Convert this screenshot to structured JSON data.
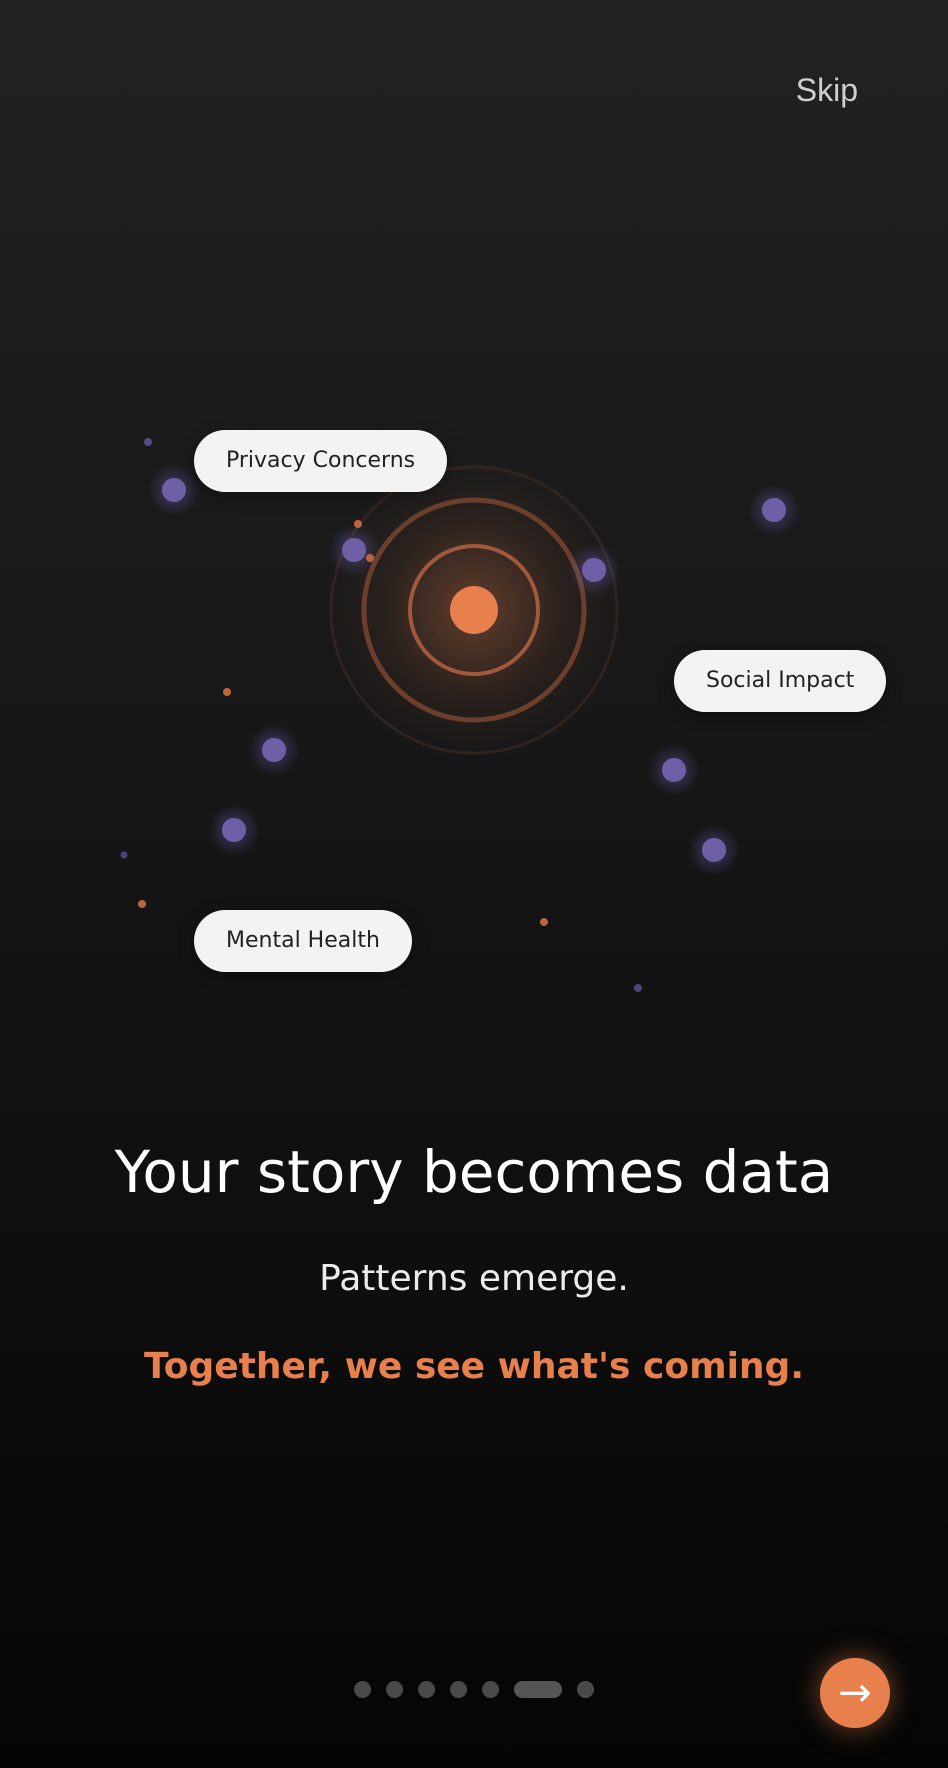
{
  "header": {
    "skip_label": "Skip"
  },
  "topics": {
    "privacy": "Privacy Concerns",
    "social": "Social Impact",
    "mental": "Mental Health"
  },
  "content": {
    "headline": "Your story becomes data",
    "subline": "Patterns emerge.",
    "accent_line": "Together, we see what's coming."
  },
  "pagination": {
    "total": 7,
    "current": 6
  },
  "next_button": {
    "icon": "arrow-right-icon",
    "glyph": "→"
  },
  "colors": {
    "accent": "#e8804e",
    "node": "#6f5fa6",
    "pill_bg": "#f3f3f3"
  }
}
